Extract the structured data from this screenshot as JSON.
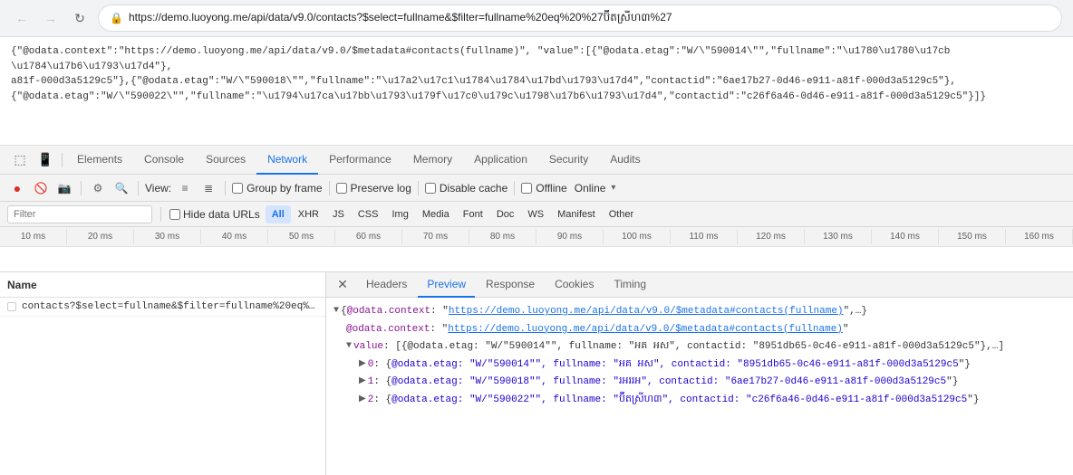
{
  "browser": {
    "url": "https://demo.luoyong.me/api/data/v9.0/contacts?$select=fullname&$filter=fullname%20eq%20%27ប៊ីតស្រីហ៣%27",
    "back_disabled": true,
    "forward_disabled": true
  },
  "json_output": {
    "line1": "{\"@odata.context\":\"https://demo.luoyong.me/api/data/v9.0/$metadata#contacts(fullname)\", \"value\":[{\"@odata.etag\":\"W/\\\"590014\\\"\",\"fullname\":\"\\u1780\\u1780\\u17cb \\u1784\\u17b6\\u1793\\u17d4\"},",
    "line2": "a81f-000d3a5129c5\"},{\"@odata.etag\":\"W/\\\"590018\\\"\",\"fullname\":\"\\u17a2\\u17c1\\u1784\\u1784\\u17bd\\u1793\\u17d4\",\"contactid\":\"6ae17b27-0d46-e911-a81f-000d3a5129c5\"},",
    "line3": "{\"@odata.etag\":\"W/\\\"590022\\\"\",\"fullname\":\"\\u1794\\u17ca\\u17bb\\u1793\\u179f\\u17c0\\u179c\\u1798\\u17b6\\u1793\\u17d4\",\"contactid\":\"c26f6a46-0d46-e911-a81f-000d3a5129c5\"}]}"
  },
  "devtools": {
    "tabs": [
      {
        "label": "Elements",
        "active": false
      },
      {
        "label": "Console",
        "active": false
      },
      {
        "label": "Sources",
        "active": false
      },
      {
        "label": "Network",
        "active": true
      },
      {
        "label": "Performance",
        "active": false
      },
      {
        "label": "Memory",
        "active": false
      },
      {
        "label": "Application",
        "active": false
      },
      {
        "label": "Security",
        "active": false
      },
      {
        "label": "Audits",
        "active": false
      }
    ],
    "toolbar": {
      "record_label": "●",
      "clear_label": "🚫",
      "camera_label": "📷",
      "filter_label": "⚙",
      "search_label": "🔍",
      "view_label": "View:",
      "list_icon": "≡",
      "tree_icon": "≣",
      "group_frame_label": "Group by frame",
      "preserve_log_label": "Preserve log",
      "disable_cache_label": "Disable cache",
      "offline_label": "Offline",
      "online_label": "Online",
      "throttle_arrow": "▾"
    },
    "filter": {
      "placeholder": "Filter",
      "hide_data_urls_label": "Hide data URLs",
      "all_label": "All",
      "xhr_label": "XHR",
      "js_label": "JS",
      "css_label": "CSS",
      "img_label": "Img",
      "media_label": "Media",
      "font_label": "Font",
      "doc_label": "Doc",
      "ws_label": "WS",
      "manifest_label": "Manifest",
      "other_label": "Other"
    },
    "timeline": {
      "labels": [
        "10 ms",
        "20 ms",
        "30 ms",
        "40 ms",
        "50 ms",
        "60 ms",
        "70 ms",
        "80 ms",
        "90 ms",
        "100 ms",
        "110 ms",
        "120 ms",
        "130 ms",
        "140 ms",
        "150 ms",
        "160 ms"
      ]
    },
    "left_panel": {
      "header": "Name",
      "request": "contacts?$select=fullname&$filter=fullname%20eq%20..."
    },
    "right_panel": {
      "tabs": [
        "Headers",
        "Preview",
        "Response",
        "Cookies",
        "Timing"
      ],
      "active_tab": "Preview",
      "response": {
        "context_key": "@odata.context",
        "context_value": "https://demo.luoyong.me/api/data/v9.0/$metadata#contacts(fullname)",
        "context_rest": ",…}",
        "context_link": "https://demo.luoyong.me/api/data/v9.0/$metadata#contacts(fullname)",
        "value_key": "value",
        "value_prefix": "[{@odata.etag: \"W/\"590014\"\", fullname: \"អគ អស\", contactid: \"8951db65-0c46-e911-a81f-000d3a5129c5\"},…]",
        "items": [
          {
            "index": 0,
            "etag": "W/\"590014\"",
            "fullname": "អគ អស",
            "contactid": "8951db65-0c46-e911-a81f-000d3a5129c5"
          },
          {
            "index": 1,
            "etag": "W/\"590018\"",
            "fullname": "រអររអ",
            "contactid": "6ae17b27-0d46-e911-a81f-000d3a5129c5"
          },
          {
            "index": 2,
            "etag": "W/\"590022\"",
            "fullname": "ប៊ីតស្រីហ៣",
            "contactid": "c26f6a46-0d46-e911-a81f-000d3a5129c5"
          }
        ]
      }
    }
  }
}
